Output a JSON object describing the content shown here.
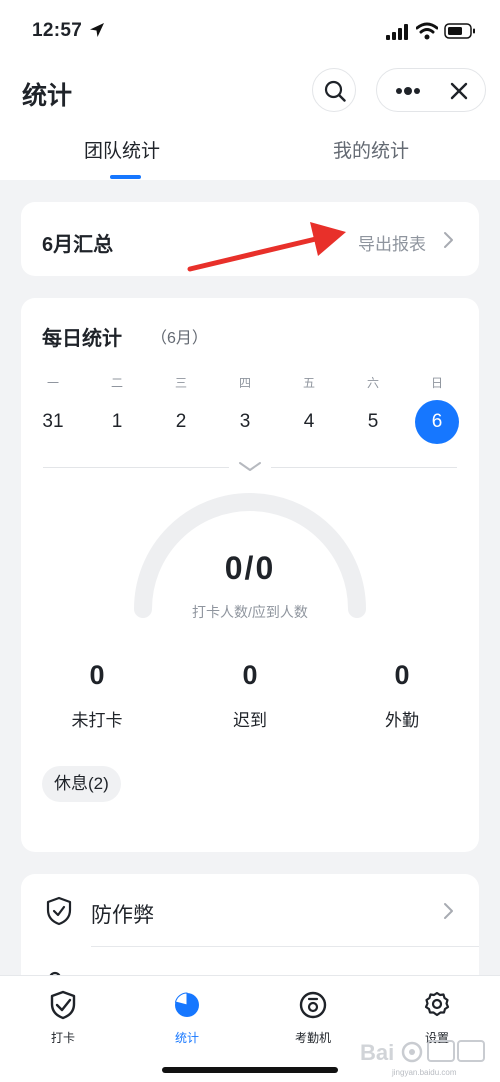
{
  "status_bar": {
    "time": "12:57"
  },
  "header": {
    "title": "统计"
  },
  "tabs": [
    {
      "label": "团队统计",
      "active": true
    },
    {
      "label": "我的统计",
      "active": false
    }
  ],
  "summary": {
    "title": "6月汇总",
    "export_label": "导出报表"
  },
  "daily": {
    "title": "每日统计",
    "month": "（6月）",
    "weekdays": [
      "一",
      "二",
      "三",
      "四",
      "五",
      "六",
      "日"
    ],
    "dates": [
      "31",
      "1",
      "2",
      "3",
      "4",
      "5",
      "6"
    ],
    "selected_date": "6",
    "gauge_value": "0/0",
    "gauge_caption": "打卡人数/应到人数",
    "stats": [
      {
        "value": "0",
        "label": "未打卡"
      },
      {
        "value": "0",
        "label": "迟到"
      },
      {
        "value": "0",
        "label": "外勤"
      }
    ],
    "chip": "休息(2)"
  },
  "menu": [
    {
      "label": "防作弊"
    }
  ],
  "tabbar": [
    {
      "label": "打卡",
      "icon": "check-shield-icon",
      "active": false
    },
    {
      "label": "统计",
      "icon": "pie-chart-icon",
      "active": true
    },
    {
      "label": "考勤机",
      "icon": "attendance-machine-icon",
      "active": false
    },
    {
      "label": "设置",
      "icon": "gear-icon",
      "active": false
    }
  ],
  "watermark": {
    "text": "jingyan.baidu.com"
  },
  "colors": {
    "accent": "#1677ff",
    "annotation_arrow": "#e8302a",
    "background": "#f2f3f5"
  }
}
